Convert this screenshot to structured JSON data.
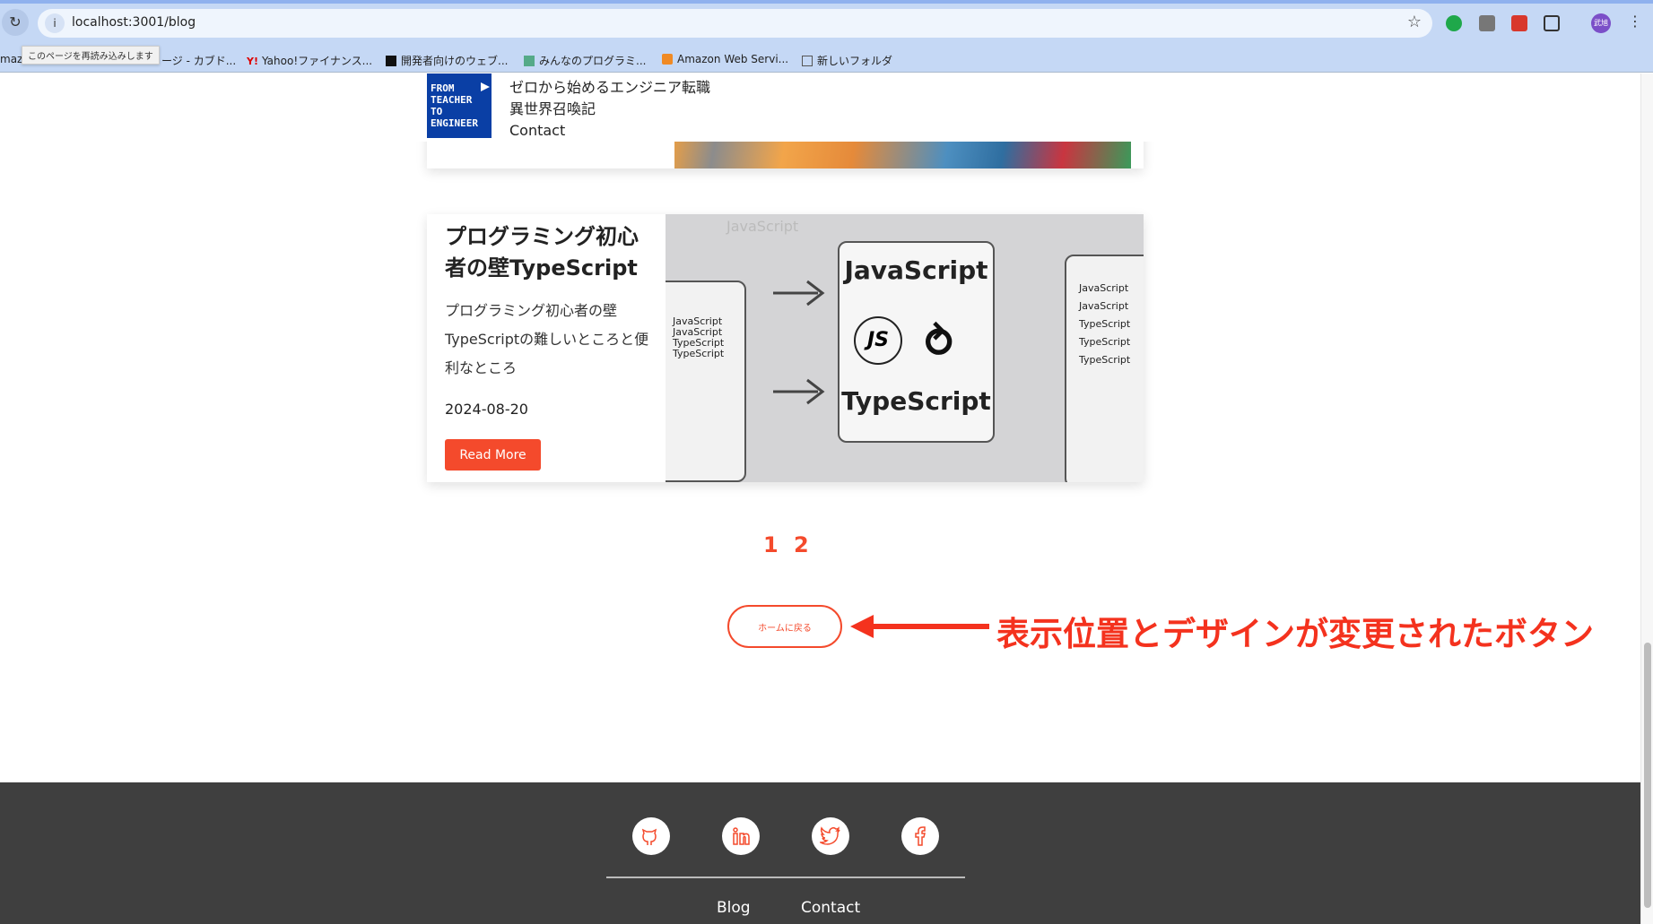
{
  "browser": {
    "url": "localhost:3001/blog",
    "reload_tooltip": "このページを再読み込みします",
    "profile": "武旭",
    "bookmarks": [
      {
        "label": "mazo..."
      },
      {
        "label": "ージ - カブド..."
      },
      {
        "label": "Yahoo!ファイナンス..."
      },
      {
        "label": "開発者向けのウェブ..."
      },
      {
        "label": "みんなのプログラミ..."
      },
      {
        "label": "Amazon Web Servi..."
      },
      {
        "label": "新しいフォルダ"
      }
    ]
  },
  "header": {
    "logo_text": "FROM TEACHER TO ENGINEER",
    "logo_lines": [
      "FROM",
      "TEACHER",
      "TO",
      "ENGINEER"
    ],
    "nav": [
      "ゼロから始めるエンジニア転職",
      "異世界召喚記",
      "Contact"
    ]
  },
  "post": {
    "title": "プログラミング初心者の壁TypeScript",
    "description": "プログラミング初心者の壁TypeScriptの難しいところと便利なところ",
    "date": "2024-08-20",
    "read_more": "Read More",
    "image_text": {
      "watermark": "JavaScript",
      "main_top": "JavaScript",
      "main_bottom": "TypeScript",
      "js": "JS",
      "left_code": [
        "JavaScript",
        "JavaScript",
        "TypeScript",
        "TypeScript"
      ],
      "right_code": [
        "JavaScript",
        "JavaScript",
        "TypeScript",
        "TypeScript",
        "TypeScript"
      ]
    }
  },
  "pagination": [
    "1",
    "2"
  ],
  "home_button": "ホームに戻る",
  "annotation": "表示位置とデザインが変更されたボタン",
  "footer": {
    "social": [
      "github",
      "linkedin",
      "twitter",
      "facebook"
    ],
    "links": [
      "Blog",
      "Contact"
    ]
  },
  "colors": {
    "accent": "#f44a2c",
    "logo": "#0a3fa5",
    "footer": "#3f3f3f",
    "annotation": "#f4321e"
  }
}
